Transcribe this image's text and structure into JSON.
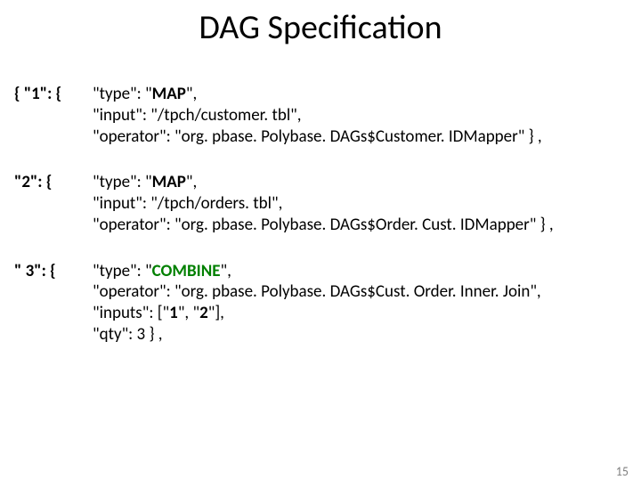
{
  "title": "DAG Specification",
  "pagenum": "15",
  "b1": {
    "key": "{ \"1\": {",
    "l1a": "\"type\": \"",
    "l1b": "MAP",
    "l1c": "\",",
    "l2": "\"input\": \"/tpch/customer. tbl\",",
    "l3": "\"operator\": \"org. pbase. Polybase. DAGs$Customer. IDMapper\" }  ,"
  },
  "b2": {
    "key": "\"2\": {",
    "l1a": "\"type\": \"",
    "l1b": "MAP",
    "l1c": "\",",
    "l2": "\"input\": \"/tpch/orders. tbl\",",
    "l3": "\"operator\": \"org. pbase. Polybase. DAGs$Order. Cust. IDMapper\" }  ,"
  },
  "b3": {
    "key": "\" 3\": {",
    "l1a": "\"type\": \"",
    "l1b": "COMBINE",
    "l1c": "\",",
    "l2": "\"operator\":  \"org. pbase. Polybase. DAGs$Cust. Order. Inner. Join\",",
    "l3a": "\"inputs\": [\"",
    "l3b": "1",
    "l3c": "\", \"",
    "l3d": "2",
    "l3e": "\"],",
    "l4": "\"qty\": 3      }  ,"
  }
}
